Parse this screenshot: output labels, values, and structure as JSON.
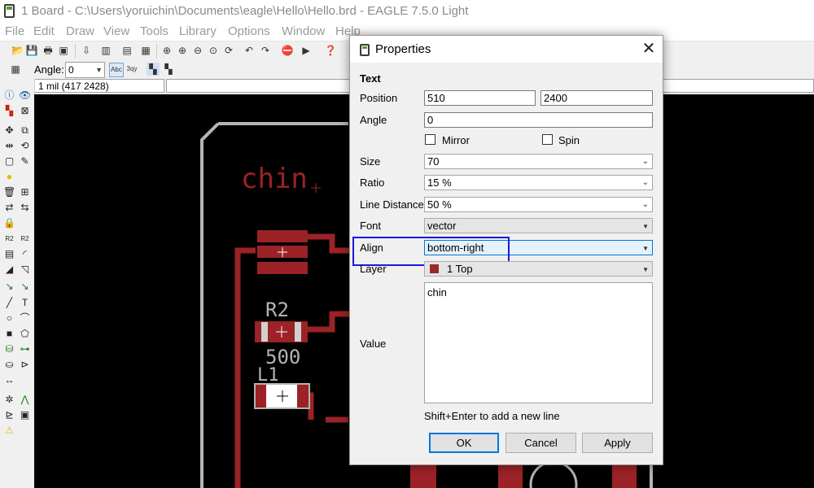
{
  "window": {
    "title": "1 Board - C:\\Users\\yoruichin\\Documents\\eagle\\Hello\\Hello.brd - EAGLE 7.5.0 Light"
  },
  "menu": [
    "File",
    "Edit",
    "Draw",
    "View",
    "Tools",
    "Library",
    "Options",
    "Window",
    "Help"
  ],
  "toolbar2": {
    "angle_label": "Angle:",
    "angle_value": "0"
  },
  "coords": "1 mil (417 2428)",
  "board": {
    "text_chin": "chin",
    "label_r2": "R2",
    "label_500": "500",
    "label_l1": "L1"
  },
  "colors": {
    "trace": "#9b2226",
    "outline": "#b4b4b4",
    "highlight": "#1a1adb",
    "focus": "#0078d7"
  },
  "dialog": {
    "title": "Properties",
    "section": "Text",
    "position_label": "Position",
    "position_x": "510",
    "position_y": "2400",
    "angle_label": "Angle",
    "angle_value": "0",
    "mirror_label": "Mirror",
    "spin_label": "Spin",
    "size_label": "Size",
    "size_value": "70",
    "ratio_label": "Ratio",
    "ratio_value": "15 %",
    "line_distance_label": "Line Distance",
    "line_distance_value": "50 %",
    "font_label": "Font",
    "font_value": "vector",
    "align_label": "Align",
    "align_value": "bottom-right",
    "layer_label": "Layer",
    "layer_value": "1 Top",
    "value_label": "Value",
    "value_text": "chin",
    "hint": "Shift+Enter to add a new line",
    "ok": "OK",
    "cancel": "Cancel",
    "apply": "Apply"
  }
}
